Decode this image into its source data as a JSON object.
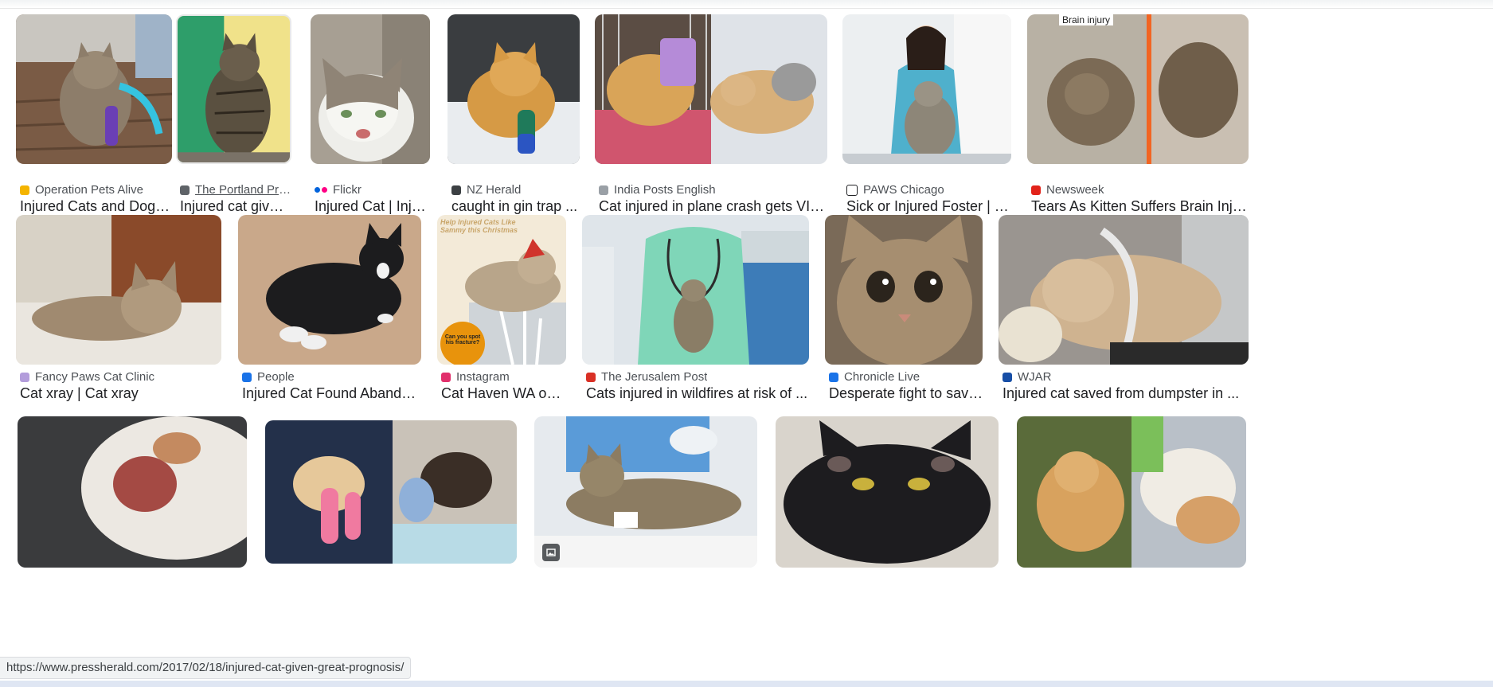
{
  "status_url": "https://www.pressherald.com/2017/02/18/injured-cat-given-great-prognosis/",
  "colors": {
    "accent": "#1a73e8",
    "text": "#202124",
    "muted": "#4d5156"
  },
  "results": [
    {
      "source": "Operation Pets Alive",
      "title": "Injured Cats and Dogs ...",
      "favicon_color": "#f4b400",
      "image": "tabby cat with purple cast on porch"
    },
    {
      "source": "The Portland Press ...",
      "title": "Injured cat given 'gr...",
      "favicon_color": "#5f6368",
      "image": "tabby cat held on table"
    },
    {
      "source": "Flickr",
      "title": "Injured Cat | Injured...",
      "favicon_color": "#0063dc",
      "image": "white and grey cat with injured nose"
    },
    {
      "source": "NZ Herald",
      "title": "caught in gin trap ...",
      "favicon_color": "#3c4043",
      "image": "orange cat with green bandaged leg"
    },
    {
      "source": "India Posts English",
      "title": "Cat injured in plane crash gets VIP ...",
      "favicon_color": "#9aa0a6",
      "image": "orange cat in crate and bandaged"
    },
    {
      "source": "PAWS Chicago",
      "title": "Sick or Injured Foster | PAW...",
      "favicon_color": "#202124",
      "image": "vet holding cat"
    },
    {
      "source": "Newsweek",
      "title": "Tears As Kitten Suffers Brain Injury ...",
      "favicon_color": "#e2231a",
      "image": "kitten collage",
      "overlay_text": "Brain injury"
    },
    {
      "source": "Fancy Paws Cat Clinic",
      "title": "Cat xray | Cat xray",
      "favicon_color": "#b39ddb",
      "image": "tabby cat lying on rug"
    },
    {
      "source": "People",
      "title": "Injured Cat Found Abandoned I...",
      "favicon_color": "#1a73e8",
      "image": "black and white cat lying down"
    },
    {
      "source": "Instagram",
      "title": "Cat Haven WA on Ins...",
      "favicon_color": "#e1306c",
      "image": "cat with santa hat and xray",
      "overlay_text": "Help Injured Cats Like Sammy this Christmas",
      "bubble_text": "Can you spot his fracture?"
    },
    {
      "source": "The Jerusalem Post",
      "title": "Cats injured in wildfires at risk of ...",
      "favicon_color": "#d93025",
      "image": "vet in scrubs holding kitten"
    },
    {
      "source": "Chronicle Live",
      "title": "Desperate fight to save Ga...",
      "favicon_color": "#1a73e8",
      "image": "tabby kitten close up"
    },
    {
      "source": "WJAR",
      "title": "Injured cat saved from dumpster in ...",
      "favicon_color": "#174ea6",
      "image": "cat with cone collar"
    },
    {
      "image": "white cat with head wound"
    },
    {
      "image": "kitten with pink casts"
    },
    {
      "image": "tabby cat on vet table"
    },
    {
      "image": "black cat with scars"
    },
    {
      "image": "kittens collage"
    }
  ]
}
